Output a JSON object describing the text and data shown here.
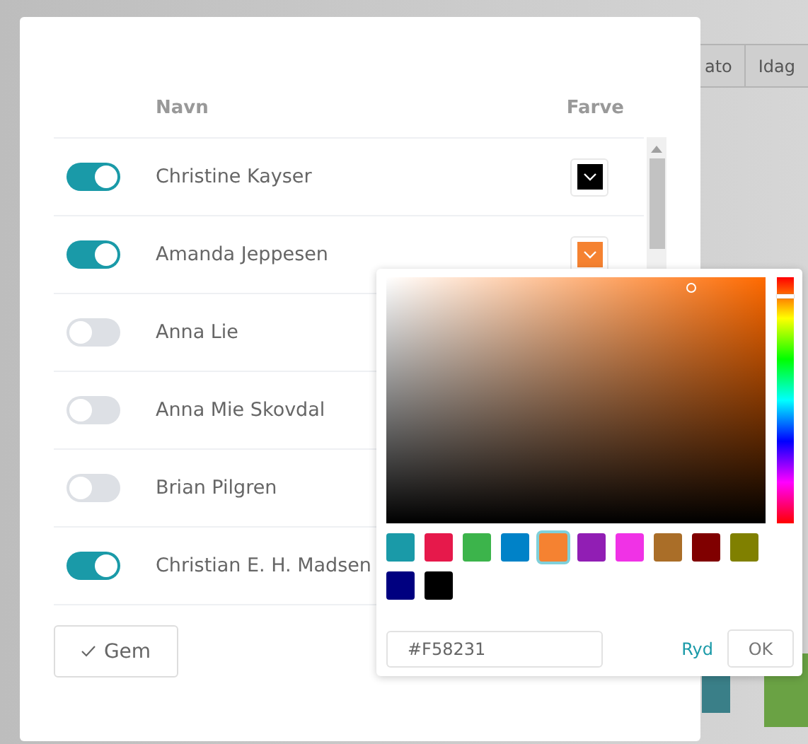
{
  "background": {
    "toolbar": [
      "ato",
      "Idag"
    ]
  },
  "table": {
    "columns": [
      "Navn",
      "Farve"
    ],
    "rows": [
      {
        "name": "Christine Kayser",
        "on": true,
        "color": "#000000"
      },
      {
        "name": "Amanda Jeppesen",
        "on": true,
        "color": "#f58231"
      },
      {
        "name": "Anna Lie",
        "on": false
      },
      {
        "name": "Anna Mie Skovdal",
        "on": false
      },
      {
        "name": "Brian Pilgren",
        "on": false
      },
      {
        "name": "Christian E. H. Madsen",
        "on": true
      }
    ]
  },
  "save_button": "Gem",
  "picker": {
    "swatches": [
      {
        "color": "#1a9aa8",
        "selected": false
      },
      {
        "color": "#e6194b",
        "selected": false
      },
      {
        "color": "#3cb44b",
        "selected": false
      },
      {
        "color": "#0082c8",
        "selected": false
      },
      {
        "color": "#f58231",
        "selected": true
      },
      {
        "color": "#911eb4",
        "selected": false
      },
      {
        "color": "#f032e6",
        "selected": false
      },
      {
        "color": "#aa6e28",
        "selected": false
      },
      {
        "color": "#800000",
        "selected": false
      },
      {
        "color": "#808000",
        "selected": false
      },
      {
        "color": "#000080",
        "selected": false
      },
      {
        "color": "#000000",
        "selected": false
      }
    ],
    "value": "#F58231",
    "clear": "Ryd",
    "ok": "OK"
  }
}
